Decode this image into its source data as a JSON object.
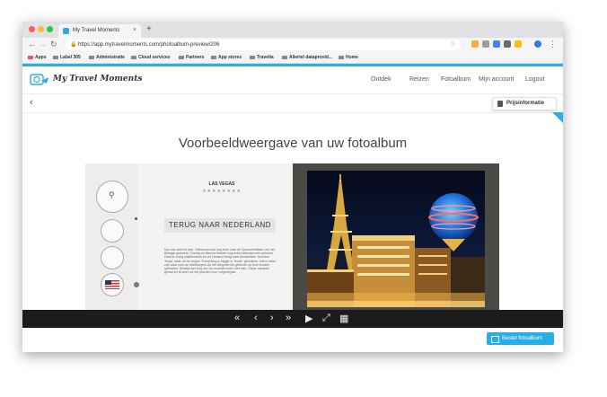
{
  "browser": {
    "tab_title": "My Travel Moments",
    "tab_close": "×",
    "new_tab": "+",
    "url": "https://app.mytravelmoments.com/photoalbum-preview/206",
    "bookmarks": [
      "Apps",
      "Label 305",
      "Administratie",
      "Cloud services",
      "Partners",
      "App stores",
      "Travelia",
      "Allertel dataprovid...",
      "Home"
    ]
  },
  "site": {
    "brand": "My Travel Moments",
    "nav": [
      "Ontdek",
      "Reizen",
      "Fotoalbum",
      "Mijn account",
      "Logout"
    ],
    "back": "‹",
    "price_button": "Prijsinformatie",
    "accent": "#2ab0e2"
  },
  "preview": {
    "title": "Voorbeeldweergave van uw fotoalbum",
    "page_heading": "LAS VEGAS",
    "stars": "★★★★★★★★",
    "home_banner": "TERUG NAAR NEDERLAND",
    "body_text": "Nou dat was het dan. Gisterenavond nog even naar de Sportsmeditase van het Bellagio geweest. Cheeky en Bianca hebben nog enkel bellowed met geboren. Daarna vroeg wakkerseerk en via Houston terug naar Amsterdam. Houston Texas, waar de de slogan \"Everything is bigger in Texas\" gebruiken. Dat is zeker ook waar voor de Hamburgers op het vliegveld die gebeure op hout worden gebraden. Slowlijk wel ving dus we moesten even met elan. Super vakantie gehad en al weer vol het plannen voor volgend jaar.",
    "photo_alt": "Las Vegas night skyline"
  },
  "controls": [
    "«",
    "‹",
    "›",
    "»",
    "▶",
    "⤢",
    "▦"
  ],
  "order_button": "Bestel fotoalbum"
}
